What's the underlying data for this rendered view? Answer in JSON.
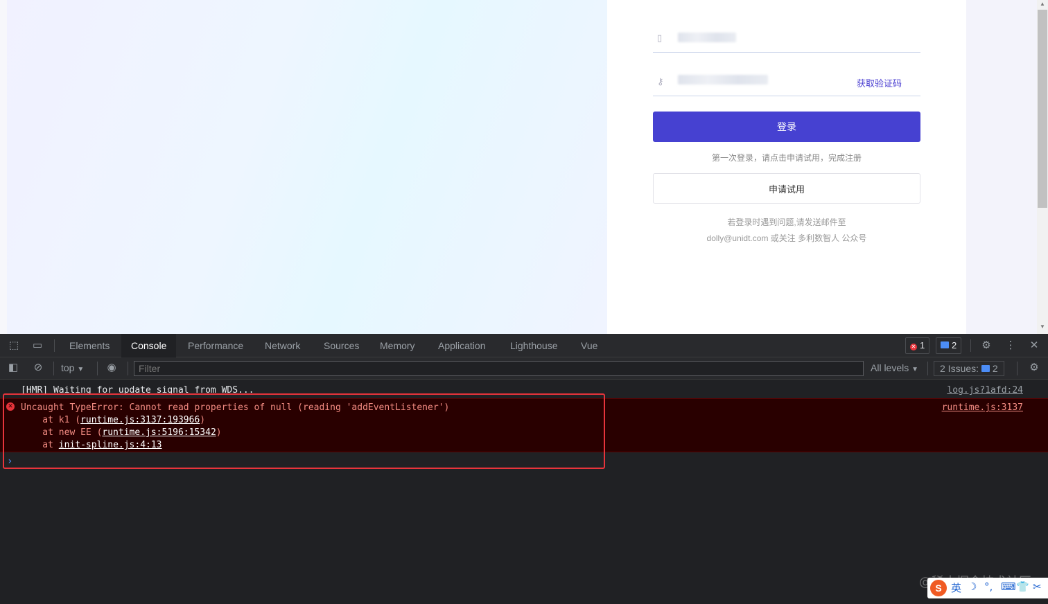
{
  "login": {
    "get_code_label": "获取验证码",
    "login_button": "登录",
    "first_login_hint": "第一次登录，请点击申请试用，完成注册",
    "trial_button": "申请试用",
    "contact_line1": "若登录时遇到问题,请发送邮件至",
    "contact_line2": "dolly@unidt.com 或关注 多利数智人 公众号"
  },
  "devtools": {
    "tabs": [
      "Elements",
      "Console",
      "Performance",
      "Network",
      "Sources",
      "Memory",
      "Application",
      "Lighthouse",
      "Vue"
    ],
    "active_tab": "Console",
    "error_count": "1",
    "message_count": "2",
    "context": "top",
    "filter_placeholder": "Filter",
    "levels": "All levels",
    "issues_label": "2 Issues:",
    "issues_count": "2"
  },
  "console": {
    "log_message": "[HMR] Waiting for update signal from WDS...",
    "log_source": "log.js?1afd:24",
    "error_message": "Uncaught TypeError: Cannot read properties of null (reading 'addEventListener')",
    "error_source": "runtime.js:3137",
    "stack": [
      {
        "prefix": "    at k1 (",
        "link": "runtime.js:3137:193966",
        "suffix": ")"
      },
      {
        "prefix": "    at new EE (",
        "link": "runtime.js:5196:15342",
        "suffix": ")"
      },
      {
        "prefix": "    at ",
        "link": "init-spline.js:4:13",
        "suffix": ""
      }
    ],
    "prompt_symbol": "›"
  },
  "overlay": {
    "watermark": "@稀土掘金技术社区",
    "ime_items": [
      "英",
      "☽",
      "°,",
      "⌨",
      "👕",
      "✂"
    ],
    "ime_logo": "S"
  },
  "colors": {
    "accent": "#4641d1",
    "error": "#e8343b",
    "error_bg": "#290000",
    "devtools_bg": "#202124"
  }
}
